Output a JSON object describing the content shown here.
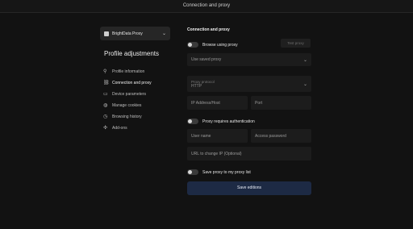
{
  "titlebar": {
    "title": "Connection and proxy"
  },
  "sidebar": {
    "profile_select": {
      "value": "BrightData Proxy"
    },
    "title": "Profile adjustments",
    "items": [
      {
        "label": "Profile information",
        "icon": "user-icon"
      },
      {
        "label": "Connection and proxy",
        "icon": "link-icon",
        "active": true
      },
      {
        "label": "Device parameters",
        "icon": "device-icon"
      },
      {
        "label": "Manage cookies",
        "icon": "cookie-icon"
      },
      {
        "label": "Browsing history",
        "icon": "history-icon"
      },
      {
        "label": "Add-ons",
        "icon": "puzzle-icon"
      }
    ]
  },
  "main": {
    "section_title": "Connection and proxy",
    "browse_proxy_label": "Browse using proxy",
    "test_proxy_label": "Test proxy",
    "saved_proxy_placeholder": "Use saved proxy",
    "proxy_protocol_label": "Proxy protocol",
    "proxy_protocol_value": "HTTP",
    "ip_placeholder": "IP Address/Host",
    "port_placeholder": "Port",
    "auth_label": "Proxy requires authentication",
    "username_placeholder": "User name",
    "password_placeholder": "Access password",
    "change_ip_placeholder": "URL to change IP (Optional)",
    "save_to_list_label": "Save proxy to my proxy list",
    "save_button": "Save editions"
  }
}
